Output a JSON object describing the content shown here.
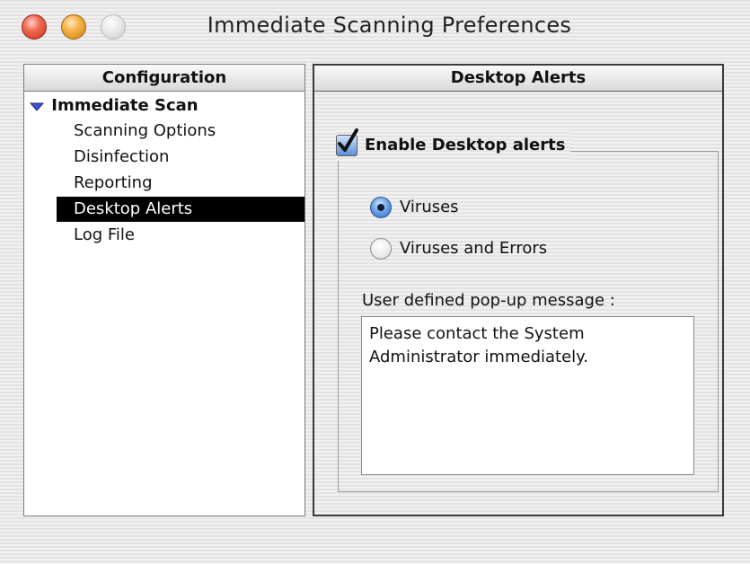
{
  "window": {
    "title": "Immediate Scanning Preferences",
    "controls": [
      "close-button",
      "minimize-button",
      "zoom-button"
    ]
  },
  "config_panel": {
    "header": "Configuration",
    "root": {
      "label": "Immediate Scan",
      "expanded": true,
      "icon": "disclosure-triangle-down"
    },
    "items": [
      {
        "label": "Scanning Options",
        "selected": false
      },
      {
        "label": "Disinfection",
        "selected": false
      },
      {
        "label": "Reporting",
        "selected": false
      },
      {
        "label": "Desktop Alerts",
        "selected": true
      },
      {
        "label": "Log File",
        "selected": false
      }
    ]
  },
  "alerts_panel": {
    "header": "Desktop Alerts",
    "enable_checkbox": {
      "label": "Enable Desktop alerts",
      "checked": true
    },
    "alert_type": {
      "options": [
        {
          "label": "Viruses",
          "selected": true
        },
        {
          "label": "Viruses and Errors",
          "selected": false
        }
      ]
    },
    "popup_message": {
      "label": "User defined pop-up message :",
      "value": "Please contact the System\nAdministrator immediately."
    }
  },
  "colors": {
    "selection_bg": "#000000",
    "checkbox_blue": "#3b6fc9",
    "close_red": "#e0442c",
    "minimize_yellow": "#f0a530"
  }
}
